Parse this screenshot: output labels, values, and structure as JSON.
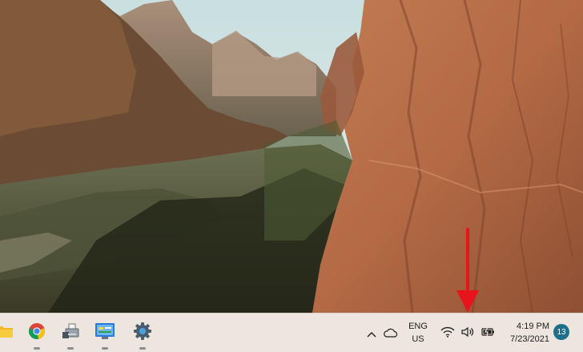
{
  "taskbar": {
    "pinned": [
      {
        "name": "file-explorer",
        "icon": "folder-icon"
      },
      {
        "name": "chrome",
        "icon": "chrome-icon"
      },
      {
        "name": "devices",
        "icon": "printer-icon"
      },
      {
        "name": "control-panel",
        "icon": "control-panel-icon"
      },
      {
        "name": "settings",
        "icon": "gear-icon"
      }
    ],
    "tray": {
      "chevron_icon": "chevron-up-icon",
      "cloud_icon": "onedrive-cloud-icon",
      "language_line1": "ENG",
      "language_line2": "US",
      "wifi_icon": "wifi-icon",
      "volume_icon": "volume-icon",
      "battery_icon": "battery-charging-icon",
      "time": "4:19 PM",
      "date": "7/23/2021",
      "notification_count": "13"
    }
  },
  "annotation": {
    "type": "red-arrow",
    "points_to": "volume-icon",
    "color": "#e8141c"
  },
  "colors": {
    "taskbar_bg": "#ece6df",
    "badge_bg": "#1f6f8b",
    "accent_red": "#e8141c"
  }
}
